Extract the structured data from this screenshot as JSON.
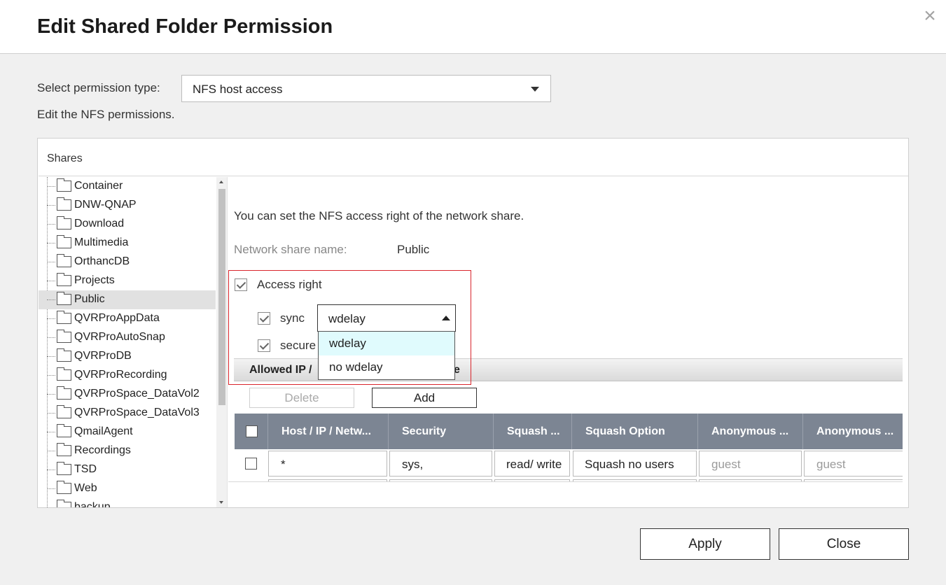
{
  "dialog": {
    "title": "Edit Shared Folder Permission",
    "close_glyph": "×"
  },
  "permission": {
    "label": "Select permission type:",
    "selected": "NFS host access",
    "description": "Edit the NFS permissions."
  },
  "shares": {
    "header": "Shares",
    "items": [
      "Container",
      "DNW-QNAP",
      "Download",
      "Multimedia",
      "OrthancDB",
      "Projects",
      "Public",
      "QVRProAppData",
      "QVRProAutoSnap",
      "QVRProDB",
      "QVRProRecording",
      "QVRProSpace_DataVol2",
      "QVRProSpace_DataVol3",
      "QmailAgent",
      "Recordings",
      "TSD",
      "Web",
      "backup"
    ],
    "selected": "Public"
  },
  "nfs": {
    "info": "You can set the NFS access right of the network share.",
    "share_name_label": "Network share name:",
    "share_name_value": "Public",
    "access_right_label": "Access right",
    "access_right_checked": true,
    "sync_label": "sync",
    "sync_checked": true,
    "sync_value": "wdelay",
    "sync_options": [
      "wdelay",
      "no wdelay"
    ],
    "secure_label": "secure",
    "secure_checked": true,
    "allowed_bar_left": "Allowed IP /",
    "allowed_bar_right": "e",
    "delete_label": "Delete",
    "add_label": "Add"
  },
  "grid": {
    "columns": [
      "Host / IP / Netw...",
      "Security",
      "Squash ...",
      "Squash Option",
      "Anonymous ...",
      "Anonymous ..."
    ],
    "rows": [
      {
        "host": "*",
        "security": "sys,",
        "squash": "read/ write",
        "squash_option": "Squash no users",
        "anon_uid": "guest",
        "anon_gid": "guest"
      }
    ]
  },
  "footer": {
    "apply_label": "Apply",
    "close_label": "Close"
  },
  "colors": {
    "grid_header": "#7c8593",
    "highlight_box": "#d9252c",
    "dropdown_highlight": "#e0fbfd"
  }
}
